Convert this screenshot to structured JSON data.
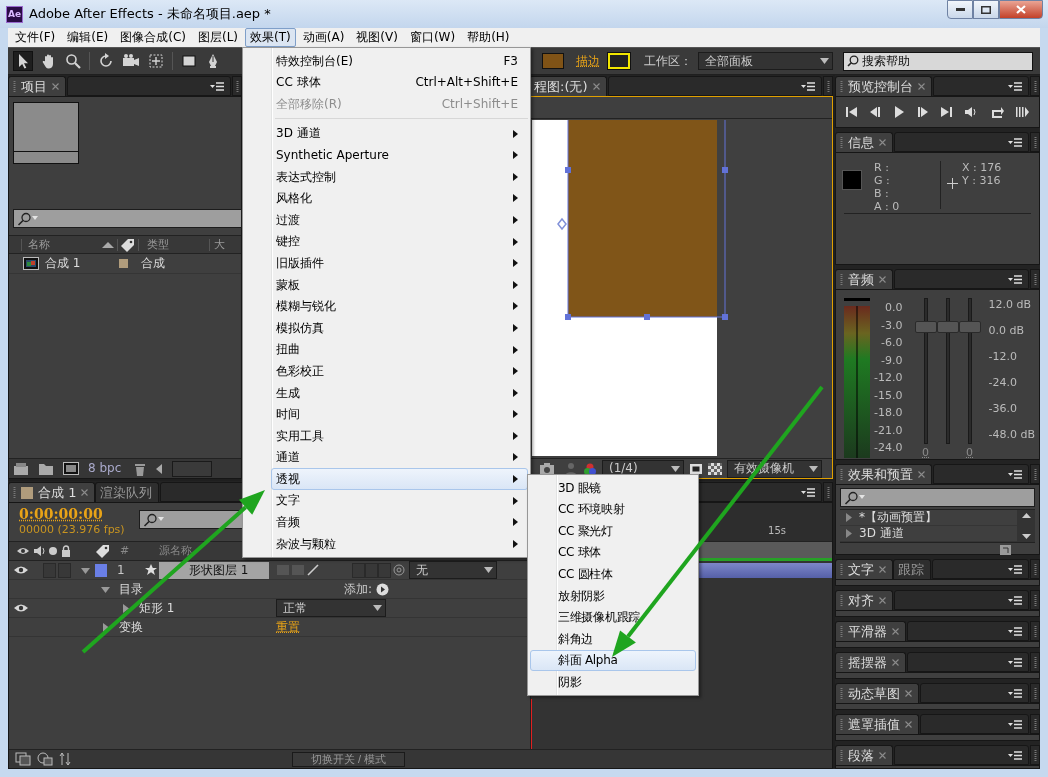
{
  "window": {
    "app_icon": "Ae",
    "title": "Adobe After Effects - 未命名项目.aep *"
  },
  "menu_bar": [
    {
      "label": "文件(F)",
      "selected": false
    },
    {
      "label": "编辑(E)",
      "selected": false
    },
    {
      "label": "图像合成(C)",
      "selected": false
    },
    {
      "label": "图层(L)",
      "selected": false
    },
    {
      "label": "效果(T)",
      "selected": true
    },
    {
      "label": "动画(A)",
      "selected": false
    },
    {
      "label": "视图(V)",
      "selected": false
    },
    {
      "label": "窗口(W)",
      "selected": false
    },
    {
      "label": "帮助(H)",
      "selected": false
    }
  ],
  "toolbar": {
    "stroke_label": "描边",
    "workspace_label": "工作区：",
    "workspace": "全部面板",
    "help_search": {
      "placeholder": "搜索帮助"
    }
  },
  "project_panel": {
    "tabs": [
      {
        "label": "项目",
        "selected": true
      }
    ],
    "columns": [
      "名称",
      "类型",
      "大"
    ],
    "items": [
      {
        "name": "合成 1",
        "type": "合成"
      }
    ],
    "bit_depth": "8 bpc"
  },
  "viewer": {
    "tabs": [
      {
        "label": "程图:(无)",
        "selected": true
      }
    ],
    "resolution": "(1/4)",
    "camera": "有效摄像机"
  },
  "timeline": {
    "tabs": [
      {
        "label": "合成 1",
        "selected": true
      },
      {
        "label": "渲染队列",
        "selected": false
      }
    ],
    "timecode": "0:00:00:00",
    "frame_info": "00000 (23.976 fps)",
    "columns": [
      "#",
      "源名称"
    ],
    "ruler_label": "15s",
    "layers": [
      {
        "number": "1",
        "name": "形状图层 1",
        "parent": "无",
        "expanded": true,
        "children": [
          {
            "kind": "contents",
            "label": "目录",
            "expanded": true,
            "action": "添加:",
            "children": [
              {
                "kind": "shape",
                "label": "矩形 1",
                "expanded": false,
                "blend_mode": "正常"
              }
            ]
          },
          {
            "kind": "transform",
            "label": "变换",
            "expanded": false,
            "link": "重置"
          }
        ]
      }
    ],
    "toggle_button": "切换开关 / 模式"
  },
  "preview_panel": {
    "tabs": [
      {
        "label": "预览控制台",
        "selected": true
      }
    ]
  },
  "info_panel": {
    "tabs": [
      {
        "label": "信息",
        "selected": true
      }
    ],
    "channels": [
      "R :",
      "G :",
      "B :",
      "A : 0"
    ],
    "position": [
      "X : 176",
      "Y : 316"
    ]
  },
  "audio_panel": {
    "tabs": [
      {
        "label": "音频",
        "selected": true
      }
    ],
    "meter_scale": [
      "0.0",
      "-3.0",
      "-6.0",
      "-9.0",
      "-12.0",
      "-15.0",
      "-18.0",
      "-21.0",
      "-24.0"
    ],
    "sliders": [
      {
        "level": 0.8
      },
      {
        "level": 0.8
      },
      {
        "level": 0.8
      }
    ],
    "db_scale": [
      "12.0 dB",
      "0.0 dB",
      "-12.0",
      "-24.0",
      "-36.0",
      "-48.0 dB"
    ],
    "channel_values": [
      "0",
      "0"
    ]
  },
  "effects_panel": {
    "tabs": [
      {
        "label": "效果和预置",
        "selected": true
      }
    ],
    "tree": [
      {
        "label": "*【动画预置】",
        "expanded": false
      },
      {
        "label": "3D 通道",
        "expanded": false
      }
    ]
  },
  "docked_panels": [
    {
      "tabs": [
        {
          "label": "文字",
          "selected": true
        },
        {
          "label": "跟踪",
          "selected": false
        }
      ]
    },
    {
      "tabs": [
        {
          "label": "对齐",
          "selected": true
        }
      ]
    },
    {
      "tabs": [
        {
          "label": "平滑器",
          "selected": true
        }
      ]
    },
    {
      "tabs": [
        {
          "label": "摇摆器",
          "selected": true
        }
      ]
    },
    {
      "tabs": [
        {
          "label": "动态草图",
          "selected": true
        }
      ]
    },
    {
      "tabs": [
        {
          "label": "遮罩插值",
          "selected": true
        }
      ]
    },
    {
      "tabs": [
        {
          "label": "段落",
          "selected": true
        }
      ]
    }
  ],
  "effect_menu": {
    "items": [
      {
        "kind": "command",
        "label": "特效控制台(E)",
        "shortcut": "F3",
        "disabled": false,
        "selected": false
      },
      {
        "kind": "command",
        "label": "CC 球体",
        "shortcut": "Ctrl+Alt+Shift+E",
        "disabled": false,
        "selected": false
      },
      {
        "kind": "command",
        "label": "全部移除(R)",
        "shortcut": "Ctrl+Shift+E",
        "disabled": true,
        "selected": false
      },
      {
        "kind": "separator"
      },
      {
        "kind": "submenu",
        "label": "3D 通道",
        "disabled": false,
        "selected": false
      },
      {
        "kind": "submenu",
        "label": "Synthetic Aperture",
        "disabled": false,
        "selected": false
      },
      {
        "kind": "submenu",
        "label": "表达式控制",
        "disabled": false,
        "selected": false
      },
      {
        "kind": "submenu",
        "label": "风格化",
        "disabled": false,
        "selected": false
      },
      {
        "kind": "submenu",
        "label": "过渡",
        "disabled": false,
        "selected": false
      },
      {
        "kind": "submenu",
        "label": "键控",
        "disabled": false,
        "selected": false
      },
      {
        "kind": "submenu",
        "label": "旧版插件",
        "disabled": false,
        "selected": false
      },
      {
        "kind": "submenu",
        "label": "蒙板",
        "disabled": false,
        "selected": false
      },
      {
        "kind": "submenu",
        "label": "模糊与锐化",
        "disabled": false,
        "selected": false
      },
      {
        "kind": "submenu",
        "label": "模拟仿真",
        "disabled": false,
        "selected": false
      },
      {
        "kind": "submenu",
        "label": "扭曲",
        "disabled": false,
        "selected": false
      },
      {
        "kind": "submenu",
        "label": "色彩校正",
        "disabled": false,
        "selected": false
      },
      {
        "kind": "submenu",
        "label": "生成",
        "disabled": false,
        "selected": false
      },
      {
        "kind": "submenu",
        "label": "时间",
        "disabled": false,
        "selected": false
      },
      {
        "kind": "submenu",
        "label": "实用工具",
        "disabled": false,
        "selected": false
      },
      {
        "kind": "submenu",
        "label": "通道",
        "disabled": false,
        "selected": false
      },
      {
        "kind": "submenu",
        "label": "透视",
        "disabled": false,
        "selected": true
      },
      {
        "kind": "submenu",
        "label": "文字",
        "disabled": false,
        "selected": false
      },
      {
        "kind": "submenu",
        "label": "音频",
        "disabled": false,
        "selected": false
      },
      {
        "kind": "submenu",
        "label": "杂波与颗粒",
        "disabled": false,
        "selected": false
      }
    ]
  },
  "perspective_submenu": {
    "items": [
      {
        "label": "3D 眼镜",
        "selected": false
      },
      {
        "label": "CC 环境映射",
        "selected": false
      },
      {
        "label": "CC 聚光灯",
        "selected": false
      },
      {
        "label": "CC 球体",
        "selected": false
      },
      {
        "label": "CC 圆柱体",
        "selected": false
      },
      {
        "label": "放射阴影",
        "selected": false
      },
      {
        "label": "三维摄像机跟踪",
        "selected": false
      },
      {
        "label": "斜角边",
        "selected": false
      },
      {
        "label": "斜面 Alpha",
        "selected": true
      },
      {
        "label": "阴影",
        "selected": false
      }
    ]
  }
}
